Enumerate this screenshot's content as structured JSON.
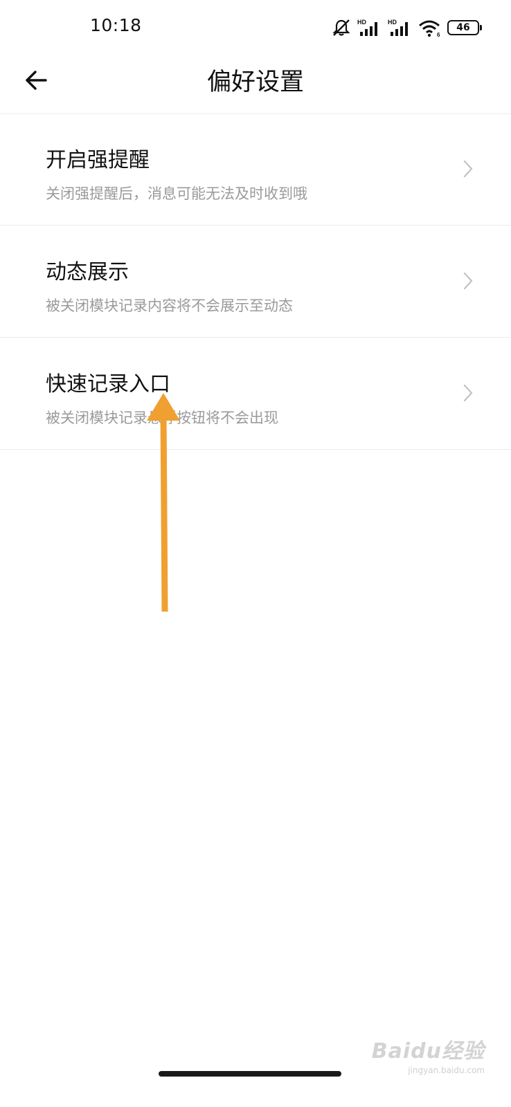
{
  "status_bar": {
    "time": "10:18",
    "battery": "46",
    "network_label": "HD",
    "icons": [
      "mute-icon",
      "signal-hd-icon",
      "signal-hd-icon",
      "wifi-icon",
      "battery-icon"
    ]
  },
  "nav": {
    "back_icon": "arrow-left-icon",
    "title": "偏好设置"
  },
  "settings": [
    {
      "title": "开启强提醒",
      "description": "关闭强提醒后，消息可能无法及时收到哦"
    },
    {
      "title": "动态展示",
      "description": "被关闭模块记录内容将不会展示至动态"
    },
    {
      "title": "快速记录入口",
      "description": "被关闭模块记录悬浮按钮将不会出现"
    }
  ],
  "annotation": {
    "color": "#f0a030",
    "icon": "arrow-up-icon"
  },
  "watermark": {
    "brand": "Baidu经验",
    "url": "jingyan.baidu.com"
  },
  "colors": {
    "text_primary": "#111111",
    "text_secondary": "#9a9a9a",
    "divider": "#ebebeb",
    "annotation_arrow": "#f0a030"
  }
}
